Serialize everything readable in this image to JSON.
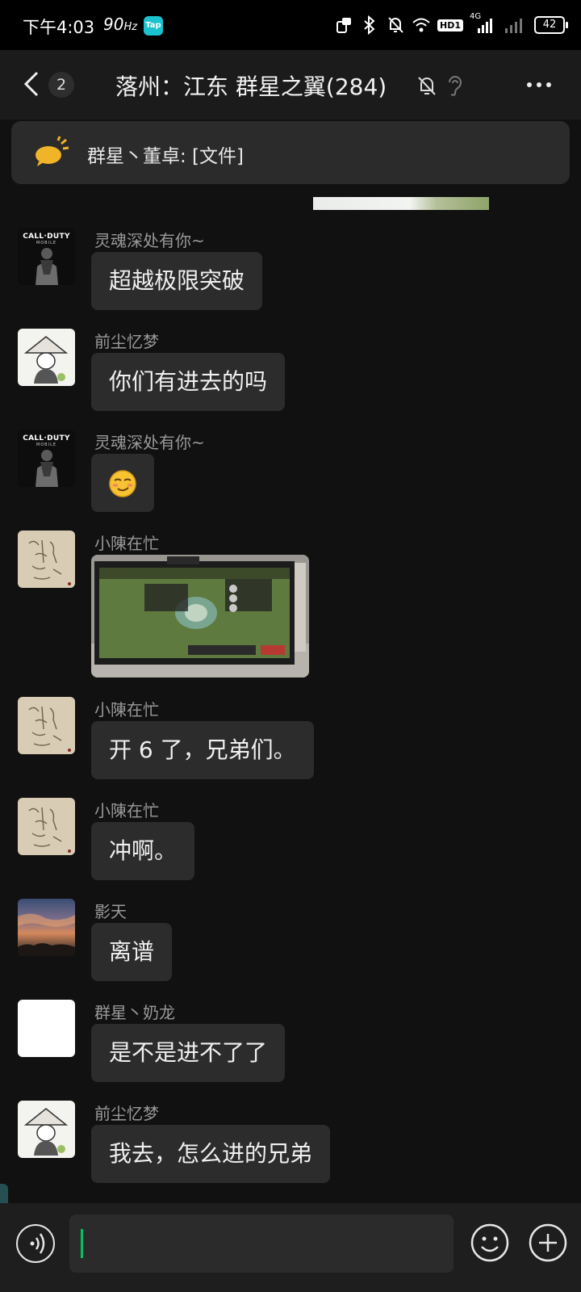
{
  "status_bar": {
    "time": "下午4:03",
    "refresh_rate": "90",
    "refresh_unit": "Hz",
    "tap_app": "Tap",
    "network": "4G",
    "hd": "HD1",
    "battery": "42"
  },
  "header": {
    "unread_count": "2",
    "title": "落州：江东  群星之翼(284)"
  },
  "notice": {
    "text": "群星丶董卓: [文件]"
  },
  "messages": [
    {
      "sender": "灵魂深处有你~",
      "text": "超越极限突破",
      "avatar": "call-of-duty-mobile"
    },
    {
      "sender": "前尘忆梦",
      "text": "你们有进去的吗",
      "avatar": "monk-cartoon"
    },
    {
      "sender": "灵魂深处有你~",
      "emoji": "smirk-emoji",
      "avatar": "call-of-duty-mobile"
    },
    {
      "sender": "小陳在忙",
      "image": "photo-of-strategy-game-on-monitor",
      "avatar": "sketch"
    },
    {
      "sender": "小陳在忙",
      "text": "开 6 了，兄弟们。",
      "avatar": "sketch"
    },
    {
      "sender": "小陳在忙",
      "text": "冲啊。",
      "avatar": "sketch"
    },
    {
      "sender": "影天",
      "text": "离谱",
      "avatar": "sunset-sky"
    },
    {
      "sender": "群星丶奶龙",
      "text": "是不是进不了了",
      "avatar": "blank-white"
    },
    {
      "sender": "前尘忆梦",
      "text": "我去，怎么进的兄弟",
      "avatar": "monk-cartoon"
    }
  ],
  "avatar_text": {
    "cod_title": "CALL·DUTY",
    "cod_sub": "MOBILE"
  },
  "input": {
    "value": ""
  },
  "colors": {
    "background": "#111111",
    "bubble": "#2c2c2c",
    "caret": "#07c160",
    "notice_icon": "#f0b429"
  }
}
